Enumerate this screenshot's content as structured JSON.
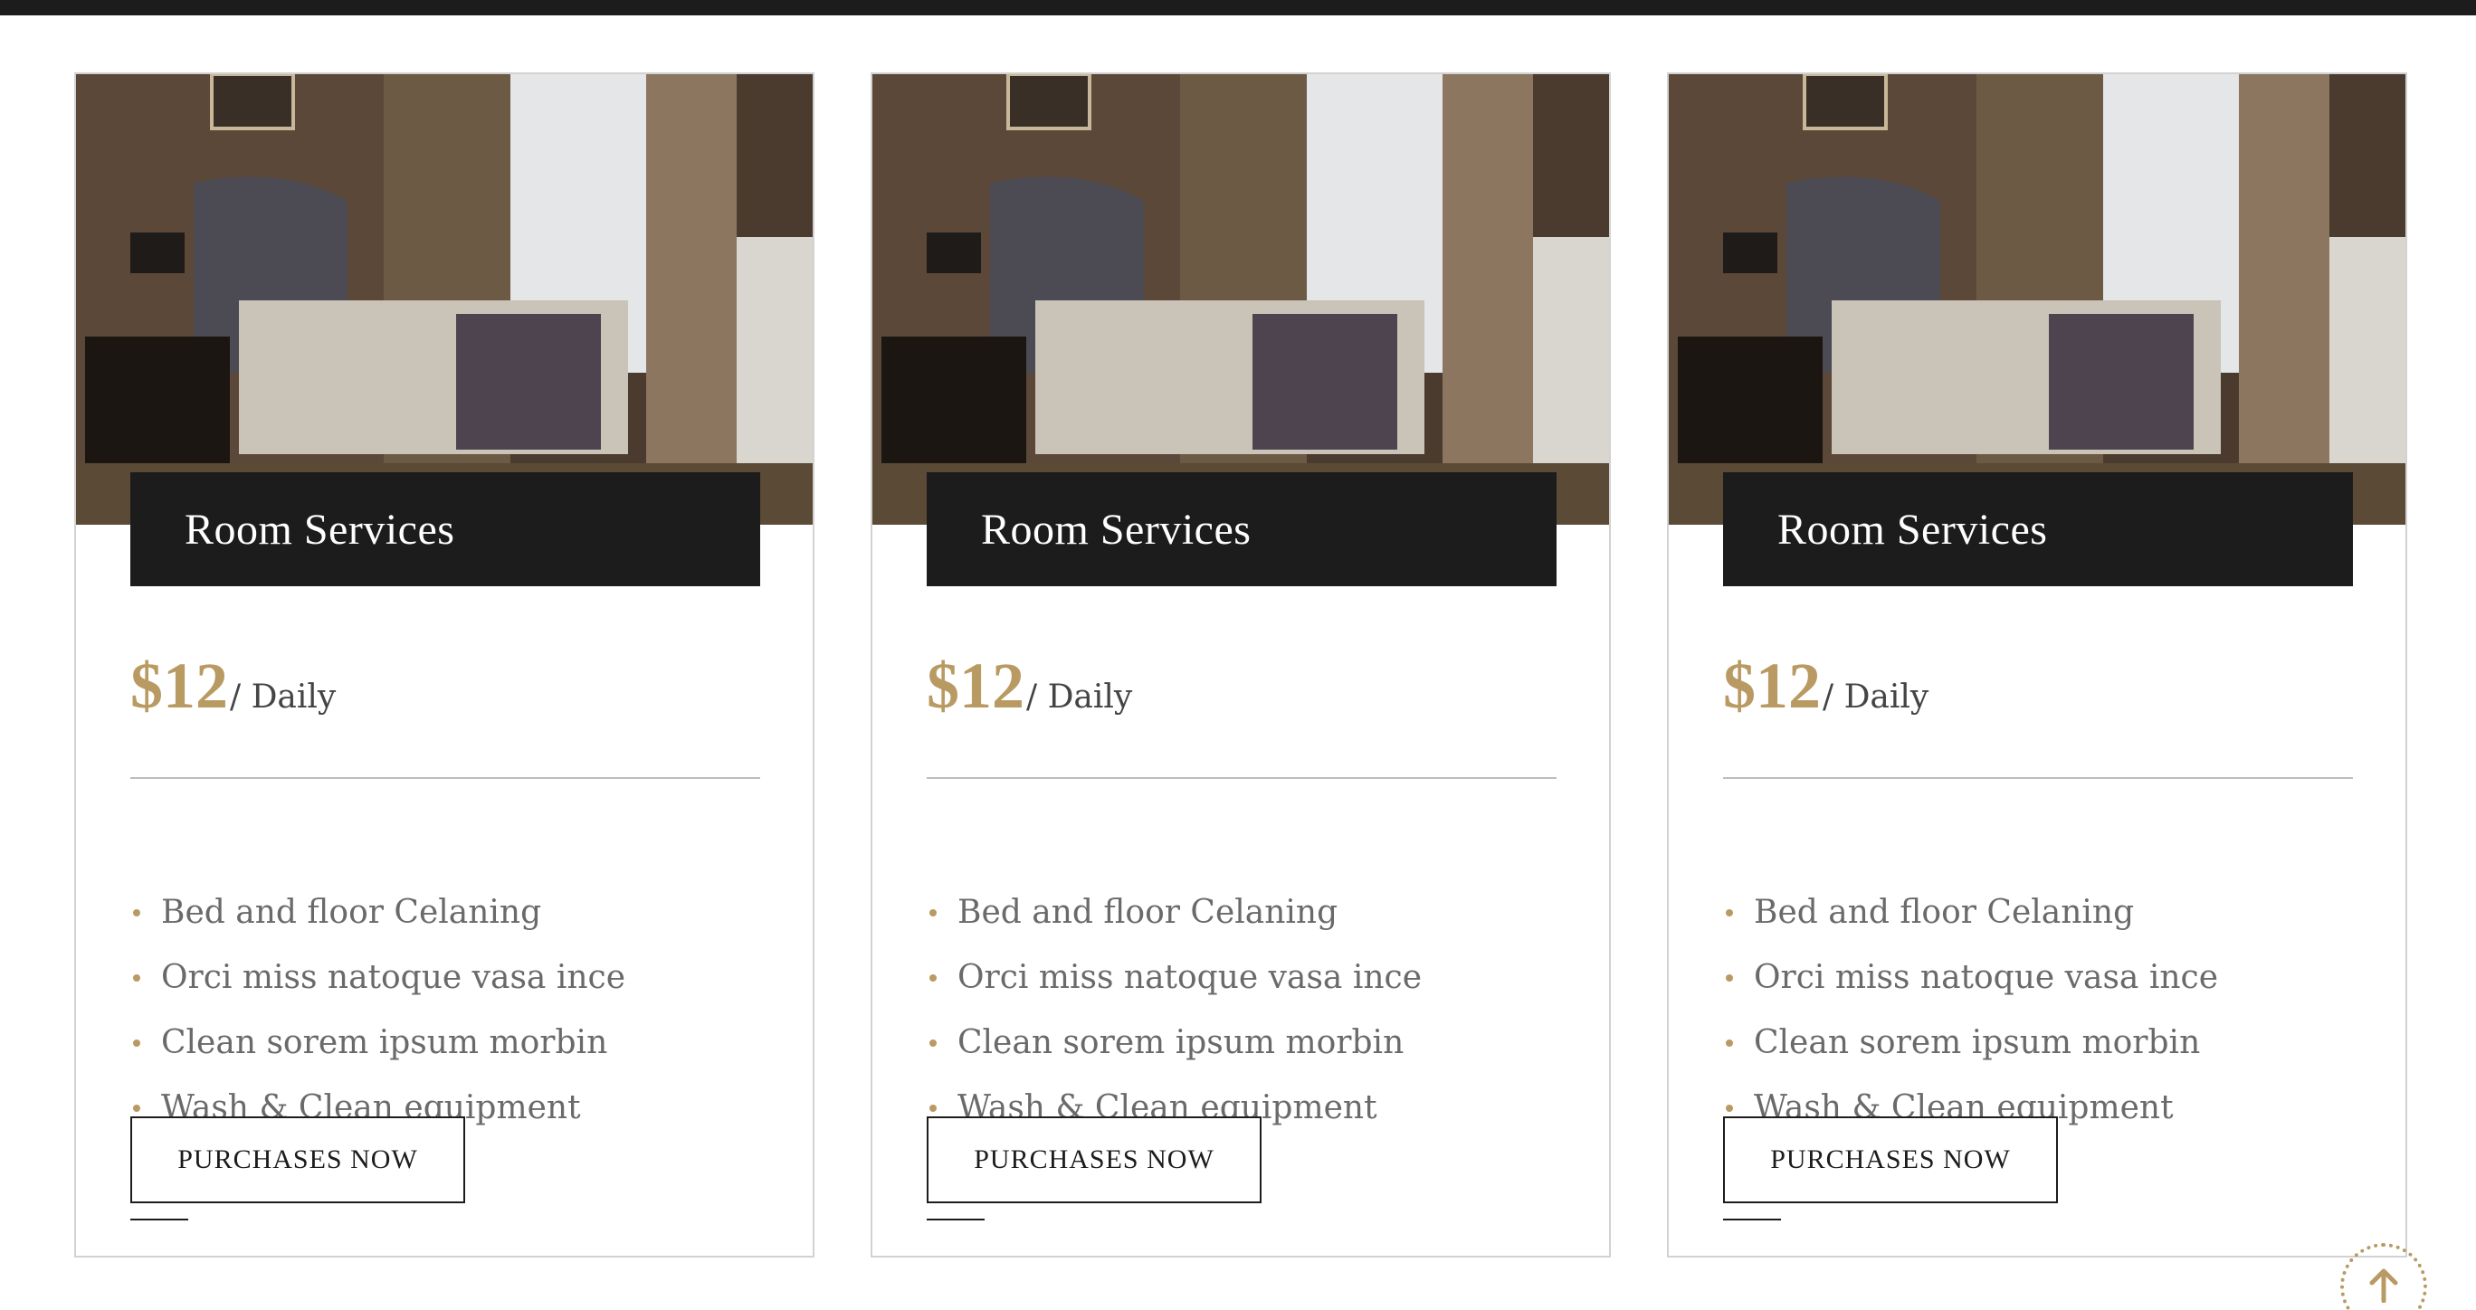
{
  "cards": [
    {
      "title": "Room Services",
      "price": "$12",
      "period": "/ Daily",
      "features": [
        "Bed and floor Celaning",
        "Orci miss natoque vasa ince",
        "Clean sorem ipsum morbin",
        "Wash & Clean equipment"
      ],
      "button_label": "PURCHASES NOW"
    },
    {
      "title": "Room Services",
      "price": "$12",
      "period": "/ Daily",
      "features": [
        "Bed and floor Celaning",
        "Orci miss natoque vasa ince",
        "Clean sorem ipsum morbin",
        "Wash & Clean equipment"
      ],
      "button_label": "PURCHASES NOW"
    },
    {
      "title": "Room Services",
      "price": "$12",
      "period": "/ Daily",
      "features": [
        "Bed and floor Celaning",
        "Orci miss natoque vasa ince",
        "Clean sorem ipsum morbin",
        "Wash & Clean equipment"
      ],
      "button_label": "PURCHASES NOW"
    }
  ],
  "scroll_top": {
    "icon": "arrow-up-icon"
  },
  "colors": {
    "accent": "#b99a62",
    "dark": "#1d1c1c",
    "border": "#d2d2d2",
    "text": "#6a6a6a"
  }
}
